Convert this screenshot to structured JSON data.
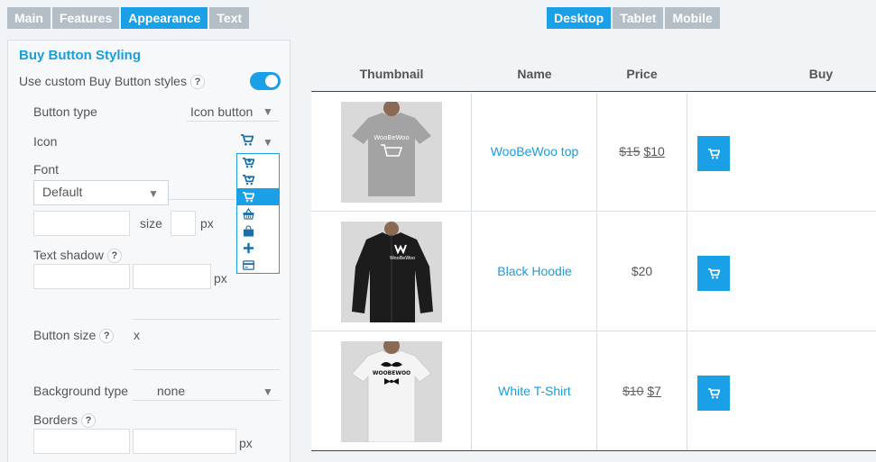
{
  "tabs": [
    "Main",
    "Features",
    "Appearance",
    "Text"
  ],
  "device_tabs": [
    "Desktop",
    "Tablet",
    "Mobile"
  ],
  "panel": {
    "title": "Buy Button Styling",
    "custom_styles_label": "Use custom Buy Button styles",
    "help": "?",
    "button_type_label": "Button type",
    "button_type_value": "Icon button",
    "icon_label": "Icon",
    "font_label": "Font",
    "font_value": "Default",
    "size_label": "size",
    "px": "px",
    "text_shadow_label": "Text shadow",
    "button_size_label": "Button size",
    "x": "x",
    "background_type_label": "Background type",
    "background_type_value": "none",
    "borders_label": "Borders"
  },
  "icon_options": [
    "cart-arrow-down",
    "cart-plus",
    "shopping-cart",
    "shopping-basket",
    "shopping-bag",
    "plus",
    "credit-card"
  ],
  "table": {
    "headers": [
      "Thumbnail",
      "Name",
      "Price",
      "Buy"
    ],
    "rows": [
      {
        "name": "WooBeWoo top",
        "old_price": "$15",
        "price": "$10",
        "thumb": "grey-tshirt",
        "shirt_color": "#a3a3a3",
        "print_text": "WooBeWoo"
      },
      {
        "name": "Black Hoodie",
        "old_price": "",
        "price": "$20",
        "thumb": "black-hoodie",
        "shirt_color": "#1c1c1c",
        "print_text": "WooBeWoo"
      },
      {
        "name": "White T-Shirt",
        "old_price": "$10",
        "price": "$7",
        "thumb": "white-tshirt",
        "shirt_color": "#f4f4f4",
        "print_text": "WOOBEWOO"
      }
    ]
  },
  "colors": {
    "accent": "#1aa0e6",
    "tab_inactive": "#b3bec6",
    "link": "#1a9ddb"
  }
}
